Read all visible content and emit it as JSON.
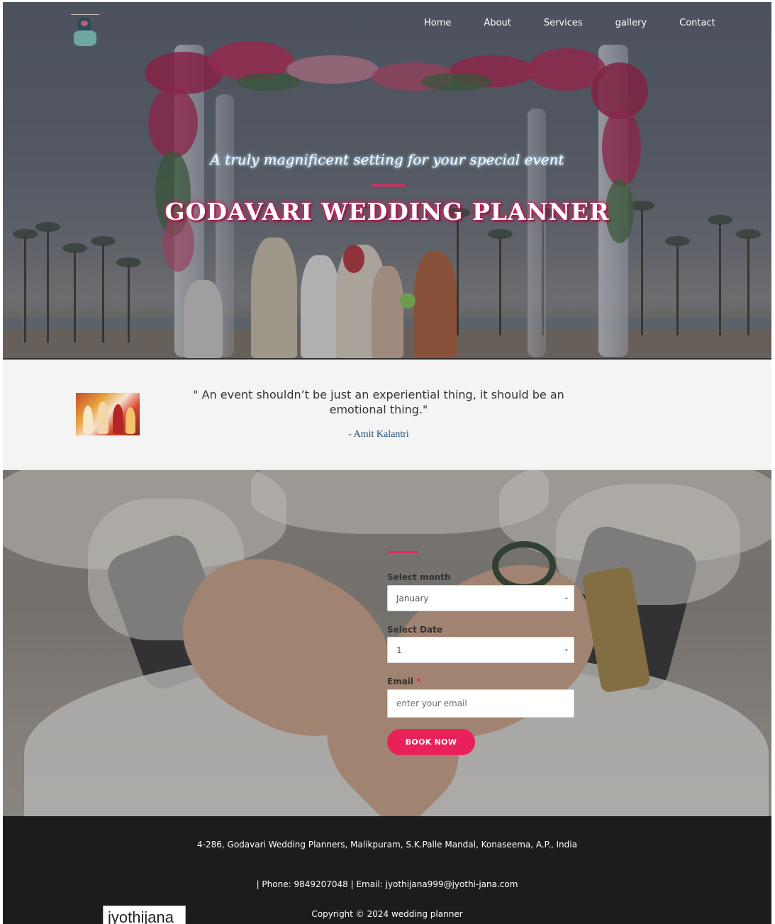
{
  "nav": {
    "items": [
      {
        "label": "Home"
      },
      {
        "label": "About"
      },
      {
        "label": "Services"
      },
      {
        "label": "gallery"
      },
      {
        "label": "Contact"
      }
    ]
  },
  "hero": {
    "tagline": "A truly magnificent setting for your special event",
    "title": "GODAVARI WEDDING PLANNER"
  },
  "quote": {
    "text": "\" An event shouldn’t be just an experiential thing, it should be an emotional thing.\"",
    "author": "- Amit Kalantri"
  },
  "booking": {
    "month_label": "Select month",
    "month_value": "January",
    "date_label": "Select Date",
    "date_value": "1",
    "email_label": "Email",
    "email_required_mark": "*",
    "email_placeholder": "enter your email",
    "button_label": "BOOK NOW"
  },
  "footer": {
    "address": "4-286, Godavari Wedding Planners, Malikpuram, S.K.Palle Mandal, Konaseema, A.P., India",
    "contact": "| Phone: 9849207048 | Email: jyothijana999@jyothi-jana.com",
    "copyright": "Copyright © 2024 wedding planner",
    "badge": "jyothijana"
  },
  "colors": {
    "accent": "#e8275f",
    "footer_bg": "#1c1c1c",
    "quote_bg": "#f4f4f4"
  },
  "icons": {
    "select_arrow": "chevron-down-icon"
  }
}
